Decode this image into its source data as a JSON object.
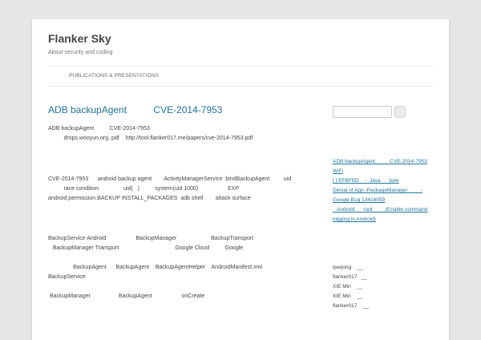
{
  "site": {
    "title": "Flanker Sky",
    "description": "About security and coding"
  },
  "nav": {
    "items": [
      {
        "label": "PUBLICATIONS & PRESENTATIONS"
      }
    ]
  },
  "post": {
    "title": "ADB backupAgent          CVE-2014-7953",
    "paragraphs": [
      "ADB backupAgent          CVE-2014-7953",
      "          drops.wooyun.org. pdf    http://tool.flanker017.me/papers/cve-2014-7953.pdf",
      "CVE-2014-7953      android backup agent        ActivityManagerService  bindBackupAgent         uid",
      "          race condition                uid(   )          system(uid 1000)                   EXP",
      "android.permission.BACKUP INSTALL_PACKAGES  adb shell        attack surface",
      "BackupService Android                   BackupManager                      BackupTransport",
      "   BackupManager Transport                                    Google Cloud          Google",
      "                BackupAgent      BackupAgent    BackupAgentHelper    AndroidManifest.xml",
      "BackupService",
      " BackupManager                  BackupAgent                   onCreate"
    ]
  },
  "sidebar": {
    "search": {
      "placeholder": "",
      "button_label": ""
    },
    "recent_posts": [
      "ADB backupAgent          CVE-2014-7953",
      "WiFi",
      "[ ] EFBFBD    -  Java      byte",
      "Denial of App -PackageManager         -",
      "Google Bug 13416059",
      "   Android      root         (Enable command",
      "logging in Android)"
    ],
    "recent_comments": [
      "quejong    __",
      "flanker017   __",
      "XIE Min    __",
      "XIE Min    __",
      "flanker017    __"
    ]
  }
}
